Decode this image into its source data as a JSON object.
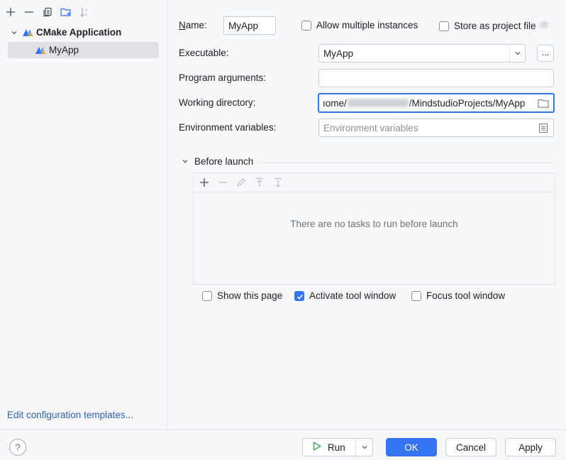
{
  "tree": {
    "group_label": "CMake Application",
    "item_label": "MyApp"
  },
  "left_footer": {
    "edit_templates_label": "Edit configuration templates..."
  },
  "form": {
    "name_label": "Name:",
    "name_value": "MyApp",
    "allow_multiple_label": "Allow multiple instances",
    "allow_multiple_checked": false,
    "store_project_label": "Store as project file",
    "store_project_checked": false,
    "executable_label": "Executable:",
    "executable_value": "MyApp",
    "executable_browse_label": "...",
    "program_args_label": "Program arguments:",
    "program_args_value": "",
    "working_dir_label": "Working directory:",
    "working_dir_prefix": "ıome/",
    "working_dir_suffix": "/MindstudioProjects/MyApp",
    "env_vars_label": "Environment variables:",
    "env_vars_placeholder": "Environment variables"
  },
  "before_launch": {
    "title": "Before launch",
    "empty_text": "There are no tasks to run before launch",
    "show_page_label": "Show this page",
    "show_page_checked": false,
    "activate_tool_label": "Activate tool window",
    "activate_tool_checked": true,
    "focus_tool_label": "Focus tool window",
    "focus_tool_checked": false
  },
  "buttons": {
    "help_label": "?",
    "run_label": "Run",
    "ok_label": "OK",
    "cancel_label": "Cancel",
    "apply_label": "Apply"
  },
  "colors": {
    "accent": "#3574f0",
    "link": "#2f5fb3",
    "selection": "#dfe1e5"
  }
}
